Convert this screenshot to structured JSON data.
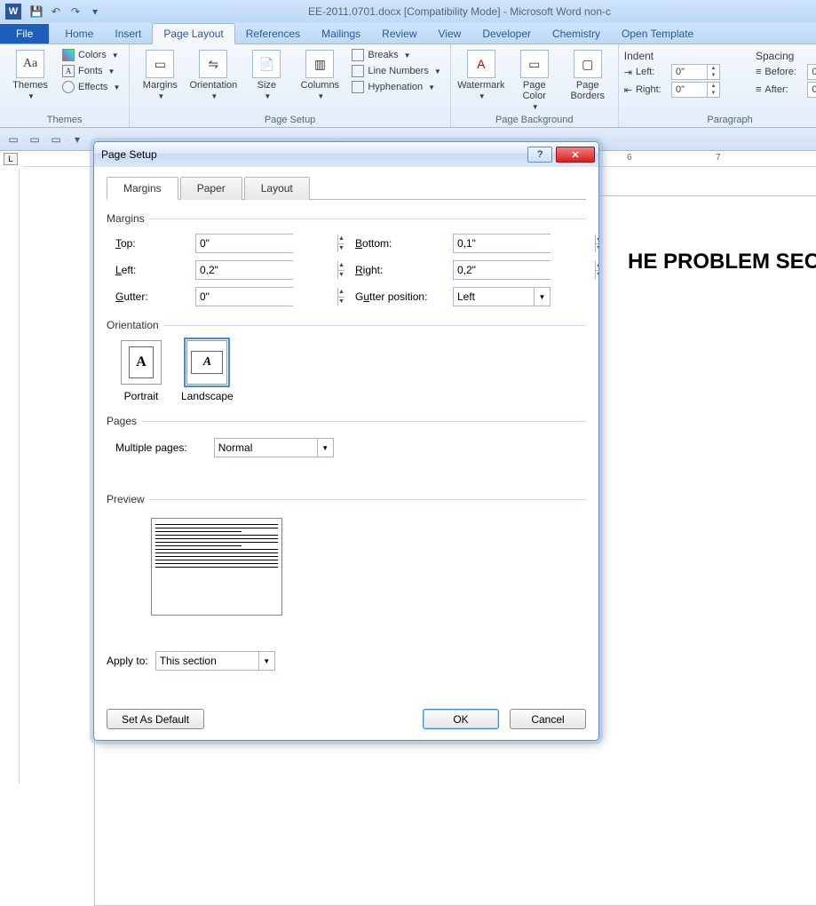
{
  "titlebar": {
    "word_glyph": "W",
    "doc_title": "EE-2011.0701.docx [Compatibility Mode] - Microsoft Word non-c"
  },
  "ribbon_tabs": {
    "file": "File",
    "home": "Home",
    "insert": "Insert",
    "page_layout": "Page Layout",
    "references": "References",
    "mailings": "Mailings",
    "review": "Review",
    "view": "View",
    "developer": "Developer",
    "chemistry": "Chemistry",
    "open_template": "Open Template"
  },
  "ribbon": {
    "themes": {
      "themes": "Themes",
      "colors": "Colors",
      "fonts": "Fonts",
      "effects": "Effects",
      "group": "Themes"
    },
    "page_setup": {
      "margins": "Margins",
      "orientation": "Orientation",
      "size": "Size",
      "columns": "Columns",
      "breaks": "Breaks",
      "line_numbers": "Line Numbers",
      "hyphenation": "Hyphenation",
      "group": "Page Setup"
    },
    "page_bg": {
      "watermark": "Watermark",
      "page_color": "Page\nColor",
      "page_borders": "Page\nBorders",
      "group": "Page Background"
    },
    "paragraph": {
      "indent_head": "Indent",
      "spacing_head": "Spacing",
      "left": "Left:",
      "right": "Right:",
      "before": "Before:",
      "after": "After:",
      "left_val": "0\"",
      "right_val": "0\"",
      "before_val": "0",
      "after_val": "0",
      "group": "Paragraph"
    }
  },
  "ruler_corner": "L",
  "document": {
    "heading": "HE PROBLEM SECTIO"
  },
  "dialog": {
    "title": "Page Setup",
    "tabs": {
      "margins": "Margins",
      "paper": "Paper",
      "layout": "Layout"
    },
    "sections": {
      "margins": "Margins",
      "orientation": "Orientation",
      "pages": "Pages",
      "preview": "Preview"
    },
    "margins": {
      "top_lbl": "Top:",
      "bottom_lbl": "Bottom:",
      "left_lbl": "Left:",
      "right_lbl": "Right:",
      "gutter_lbl": "Gutter:",
      "gutter_pos_lbl": "Gutter position:",
      "top": "0\"",
      "bottom": "0,1\"",
      "left": "0,2\"",
      "right": "0,2\"",
      "gutter": "0\"",
      "gutter_pos": "Left"
    },
    "orientation": {
      "portrait": "Portrait",
      "landscape": "Landscape",
      "glyph": "A"
    },
    "pages": {
      "multiple_lbl": "Multiple pages:",
      "multiple_val": "Normal"
    },
    "apply": {
      "lbl": "Apply to:",
      "val": "This section"
    },
    "buttons": {
      "default": "Set As Default",
      "ok": "OK",
      "cancel": "Cancel"
    }
  }
}
